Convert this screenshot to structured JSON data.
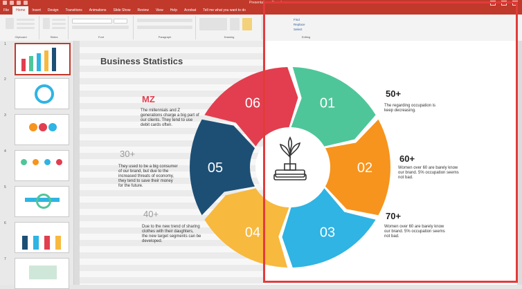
{
  "window": {
    "title": "Presentation - Saved"
  },
  "ribbon": {
    "tabs": [
      "File",
      "Home",
      "Insert",
      "Design",
      "Transitions",
      "Animations",
      "Slide Show",
      "Review",
      "View",
      "Help",
      "Acrobat",
      "Tell me what you want to do"
    ],
    "groups": [
      "Clipboard",
      "Slides",
      "Font",
      "Paragraph",
      "Drawing",
      "Editing"
    ],
    "editing": [
      "Find",
      "Replace",
      "Select"
    ]
  },
  "slide_panel": {
    "numbers": [
      "1",
      "2",
      "3",
      "4",
      "5",
      "6",
      "7"
    ]
  },
  "slide": {
    "title": "Business Statistics",
    "left_stats": [
      {
        "value": "MZ",
        "text": [
          "The millennials and Z",
          "generations charge a big part of",
          "our clients. They tend to use",
          "debit cards often."
        ]
      },
      {
        "value": "30+",
        "text": [
          "They used to be a big consumer",
          "of our brand, but due to the",
          "increased  threats of economy,",
          "they tend to save their money",
          "for the future."
        ]
      },
      {
        "value": "40+",
        "text": [
          "Due to the new trend of sharing",
          "clothes with their daughters,",
          "the new target segments can be",
          "developed."
        ]
      }
    ],
    "right_stats": [
      {
        "value": "50+",
        "text": [
          "The regarding occupation is",
          "keep decreasing."
        ]
      },
      {
        "value": "60+",
        "text": [
          "Women over 60 are barely know",
          "our brand. 5% occupation seems",
          "not bad."
        ]
      },
      {
        "value": "70+",
        "text": [
          "Women over 60 are barely know",
          "our brand. 5% occupation seems",
          "not bad."
        ]
      }
    ],
    "segments": [
      {
        "label": "01",
        "color": "#4fc69a"
      },
      {
        "label": "02",
        "color": "#f7941d"
      },
      {
        "label": "03",
        "color": "#2fb4e3"
      },
      {
        "label": "04",
        "color": "#f7b93e"
      },
      {
        "label": "05",
        "color": "#1d4f75"
      },
      {
        "label": "06",
        "color": "#e23e4f"
      }
    ],
    "center_icon": "money-plant-icon"
  },
  "colors": {
    "accent": "#c0392b",
    "highlight": "#e23b3b",
    "mz": "#e23e4f"
  }
}
